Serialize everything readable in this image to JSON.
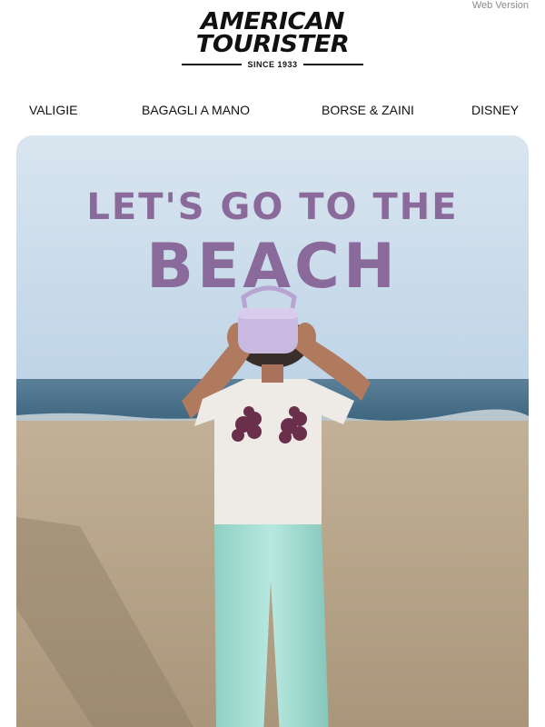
{
  "header": {
    "web_version": "Web Version",
    "logo": {
      "line1": "AMERICAN",
      "line2": "TOURISTER",
      "since": "SINCE 1933"
    }
  },
  "nav": {
    "items": [
      {
        "label": "VALIGIE"
      },
      {
        "label": "BAGAGLI A MANO"
      },
      {
        "label": "BORSE & ZAINI"
      },
      {
        "label": "DISNEY"
      }
    ]
  },
  "hero": {
    "headline_line1": "LET'S GO TO THE",
    "headline_line2": "BEACH",
    "headline_color": "#8a6a9a"
  },
  "colors": {
    "sky": "#bcd3e6",
    "sea": "#4f7490",
    "sand": "#b8a68c",
    "pants": "#9ed8cf",
    "bag": "#c9b8e0"
  }
}
